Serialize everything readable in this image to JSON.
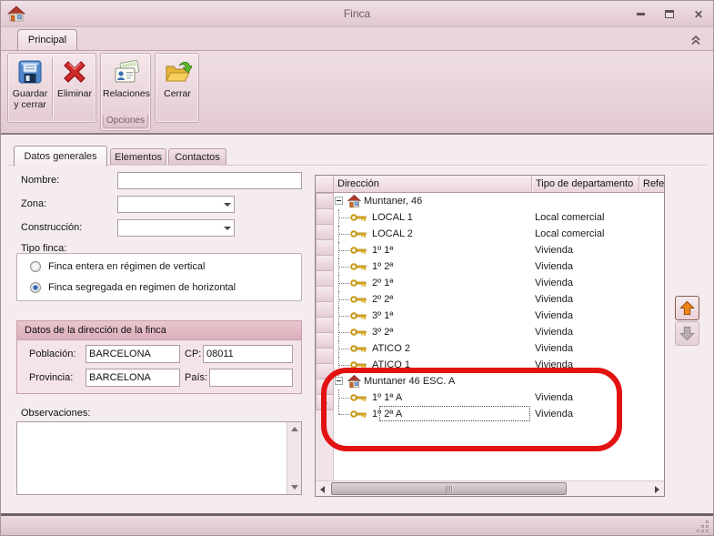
{
  "window": {
    "title": "Finca",
    "minimize": "–",
    "close": "✕"
  },
  "ribbon": {
    "tab_label": "Principal",
    "group1": {
      "save_label": "Guardar y cerrar",
      "delete_label": "Eliminar"
    },
    "group2": {
      "relaciones_label": "Relaciones",
      "caption": "Opciones"
    },
    "group3": {
      "cerrar_label": "Cerrar"
    }
  },
  "tabs": {
    "items": [
      {
        "label": "Datos generales",
        "active": true
      },
      {
        "label": "Elementos",
        "active": false
      },
      {
        "label": "Contactos",
        "active": false
      }
    ]
  },
  "form": {
    "nombre_label": "Nombre:",
    "nombre_value": "",
    "zona_label": "Zona:",
    "zona_value": "",
    "construccion_label": "Construcción:",
    "construccion_value": "",
    "tipo_finca_label": "Tipo finca:",
    "radio_options": [
      {
        "label": "Finca entera en régimen de vertical",
        "selected": false
      },
      {
        "label": "Finca segregada en regimen de horizontal",
        "selected": true
      }
    ],
    "direccion_group_title": "Datos de la dirección de la finca",
    "poblacion_label": "Población:",
    "poblacion_value": "BARCELONA",
    "cp_label": "CP:",
    "cp_value": "08011",
    "provincia_label": "Provincia:",
    "provincia_value": "BARCELONA",
    "pais_label": "País:",
    "pais_value": "",
    "observaciones_label": "Observaciones:",
    "observaciones_value": ""
  },
  "grid": {
    "columns": [
      {
        "label": "Dirección"
      },
      {
        "label": "Tipo de departamento"
      },
      {
        "label": "Refe"
      }
    ],
    "rows": [
      {
        "type": "group",
        "direccion": "Muntaner, 46",
        "tipo": ""
      },
      {
        "type": "item",
        "direccion": "LOCAL 1",
        "tipo": "Local comercial"
      },
      {
        "type": "item",
        "direccion": "LOCAL 2",
        "tipo": "Local comercial"
      },
      {
        "type": "item",
        "direccion": "1º 1ª",
        "tipo": "Vivienda"
      },
      {
        "type": "item",
        "direccion": "1º 2ª",
        "tipo": "Vivienda"
      },
      {
        "type": "item",
        "direccion": "2º 1ª",
        "tipo": "Vivienda"
      },
      {
        "type": "item",
        "direccion": "2º 2ª",
        "tipo": "Vivienda"
      },
      {
        "type": "item",
        "direccion": "3º 1ª",
        "tipo": "Vivienda"
      },
      {
        "type": "item",
        "direccion": "3º 2ª",
        "tipo": "Vivienda"
      },
      {
        "type": "item",
        "direccion": "ATICO 2",
        "tipo": "Vivienda"
      },
      {
        "type": "item",
        "direccion": "ATICO 1",
        "tipo": "Vivienda"
      },
      {
        "type": "group",
        "direccion": "Muntaner 46 ESC. A",
        "tipo": ""
      },
      {
        "type": "item",
        "direccion": "1º 1ª A",
        "tipo": "Vivienda"
      },
      {
        "type": "item",
        "direccion": "1º 2ª A",
        "tipo": "Vivienda",
        "focused": true
      }
    ]
  },
  "colors": {
    "annotation_red": "#e31212",
    "up_arrow_orange": "#f08519",
    "down_arrow_gray": "#b9aeb2",
    "theme_pink": "#e4ccd3"
  }
}
